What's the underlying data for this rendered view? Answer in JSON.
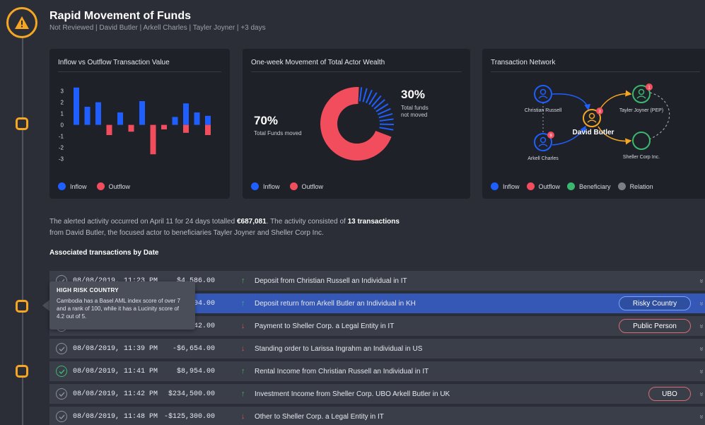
{
  "header": {
    "title": "Rapid Movement of Funds",
    "subtitle": "Not Reviewed | David Butler | Arkell Charles | Tayler Joyner | +3 days"
  },
  "colors": {
    "inflow": "#1f5fff",
    "outflow": "#f24d5c",
    "beneficiary": "#3bb86f",
    "relation": "#7b7f88",
    "accent": "#f5a623"
  },
  "card_inflow": {
    "title": "Inflow vs Outflow Transaction Value",
    "legend": {
      "inflow": "Inflow",
      "outflow": "Outflow"
    }
  },
  "card_wealth": {
    "title": "One-week Movement of Total Actor Wealth",
    "moved_pct": "70%",
    "moved_label": "Total Funds moved",
    "not_moved_pct": "30%",
    "not_moved_label_1": "Total funds",
    "not_moved_label_2": "not moved",
    "legend": {
      "inflow": "Inflow",
      "outflow": "Outflow"
    }
  },
  "card_network": {
    "title": "Transaction Network",
    "nodes": {
      "christian": "Christian Russell",
      "tayler": "Tayler Joyner (PEP)",
      "david": "David Butler",
      "arkell": "Arkell Charles",
      "sheller": "Sheller Corp Inc."
    },
    "badges": {
      "tayler": "1",
      "david": "3",
      "arkell": "9"
    },
    "legend": {
      "inflow": "Inflow",
      "outflow": "Outflow",
      "beneficiary": "Beneficiary",
      "relation": "Relation"
    }
  },
  "chart_data": [
    {
      "type": "bar",
      "title": "Inflow vs Outflow Transaction Value",
      "x": [
        1,
        2,
        3,
        4,
        5,
        6,
        7,
        8,
        9,
        10,
        11,
        12,
        13
      ],
      "series": [
        {
          "name": "Inflow",
          "values": [
            3.3,
            1.6,
            2.0,
            0,
            1.1,
            0,
            2.1,
            0,
            0,
            0.7,
            1.9,
            1.1,
            0.8
          ]
        },
        {
          "name": "Outflow",
          "values": [
            0,
            0,
            0,
            -0.9,
            0,
            -0.6,
            0,
            -2.6,
            -0.4,
            0,
            -0.7,
            0,
            -0.9
          ]
        }
      ],
      "yticks": [
        3,
        2,
        1,
        0,
        -1,
        -2,
        -3
      ],
      "ylim": [
        -3.4,
        3.6
      ],
      "legend_position": "bottom-left"
    },
    {
      "type": "pie",
      "title": "One-week Movement of Total Actor Wealth",
      "slices": [
        {
          "label": "Total Funds moved",
          "value": 70
        },
        {
          "label": "Total funds not moved",
          "value": 30
        }
      ]
    }
  ],
  "summary": {
    "part1": "The alerted activity occurred on April 11 for 24 days totalled ",
    "total": "€687,081",
    "part2": ". The activity consisted of ",
    "count": "13 transactions",
    "part3": "from David Butler, the focused actor to beneficiaries Tayler Joyner and Sheller Corp Inc."
  },
  "transactions_title": "Associated transactions by Date",
  "transactions": [
    {
      "date": "08/08/2019, 11:23 PM",
      "amount": "$4,586.00",
      "direction": "↑",
      "description": "Deposit from Christian Russell an Individual in IT",
      "tag": "",
      "checked": false
    },
    {
      "date": "",
      "amount": "5,804.00",
      "direction": "↑",
      "description": "Deposit return from Arkell Butler an Individual in KH",
      "tag": "Risky Country",
      "checked": false
    },
    {
      "date": "",
      "amount": "42.00",
      "direction": "↓",
      "description": "Payment to Sheller Corp. a Legal Entity in IT",
      "tag": "Public Person",
      "checked": false
    },
    {
      "date": "08/08/2019, 11:39 PM",
      "amount": "-$6,654.00",
      "direction": "↓",
      "description": "Standing order to Larissa Ingrahm an Individual in US",
      "tag": "",
      "checked": false
    },
    {
      "date": "08/08/2019, 11:41 PM",
      "amount": "$8,954.00",
      "direction": "↑",
      "description": "Rental Income from Christian Russell an Individual in IT",
      "tag": "",
      "checked": true
    },
    {
      "date": "08/08/2019, 11:42 PM",
      "amount": "$234,500.00",
      "direction": "↑",
      "description": "Investment Income from Sheller Corp. UBO Arkell Butler in UK",
      "tag": "UBO",
      "checked": false
    },
    {
      "date": "08/08/2019, 11:48 PM",
      "amount": "-$125,300.00",
      "direction": "↓",
      "description": "Other to Sheller Corp. a Legal Entity in IT",
      "tag": "",
      "checked": false
    }
  ],
  "tooltip": {
    "title": "HIGH RISK COUNTRY",
    "body": "Cambodia has a Basel AML index score of over 7 and a rank of 100, while it has a Lucinity score of 4.2 out of 5."
  }
}
